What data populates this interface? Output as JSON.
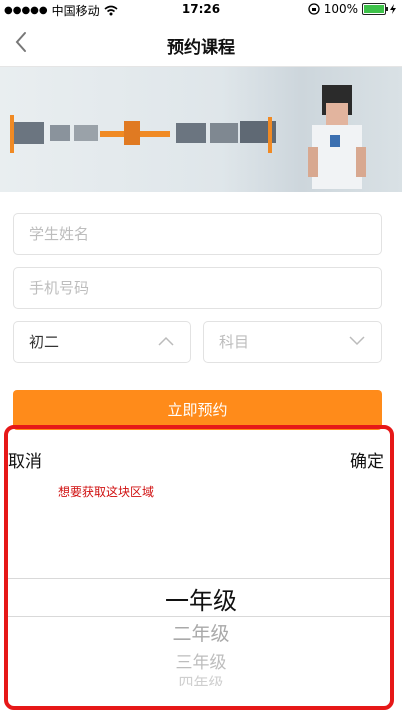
{
  "status_bar": {
    "carrier": "中国移动",
    "time": "17:26",
    "battery": "100%"
  },
  "nav": {
    "title": "预约课程"
  },
  "form": {
    "student_name_placeholder": "学生姓名",
    "phone_placeholder": "手机号码",
    "grade_value": "初二",
    "subject_placeholder": "科目",
    "submit_label": "立即预约"
  },
  "picker": {
    "cancel_label": "取消",
    "confirm_label": "确定",
    "annotation": "想要获取这块区域",
    "options": [
      "一年级",
      "二年级",
      "三年级",
      "四年级"
    ]
  },
  "colors": {
    "accent": "#ff8b1a",
    "highlight_border": "#e61818",
    "annotation": "#d01010"
  }
}
